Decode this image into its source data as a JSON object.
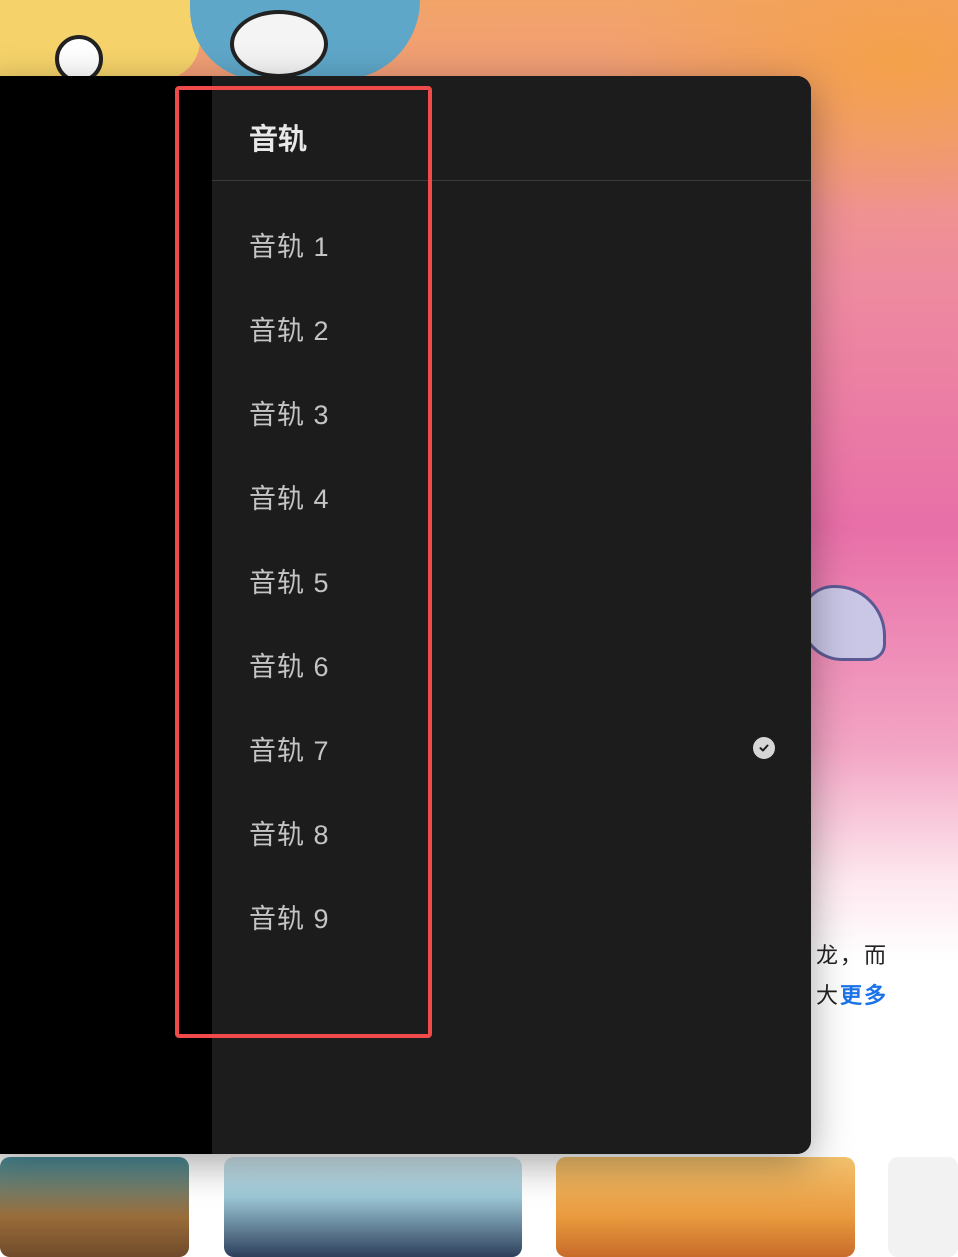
{
  "background": {
    "description_text_line1": "龙，而",
    "description_text_line2": "大",
    "more_link": "更多"
  },
  "audio_panel": {
    "title": "音轨",
    "tracks": [
      {
        "label": "音轨 1",
        "selected": false
      },
      {
        "label": "音轨 2",
        "selected": false
      },
      {
        "label": "音轨 3",
        "selected": false
      },
      {
        "label": "音轨 4",
        "selected": false
      },
      {
        "label": "音轨 5",
        "selected": false
      },
      {
        "label": "音轨 6",
        "selected": false
      },
      {
        "label": "音轨 7",
        "selected": true
      },
      {
        "label": "音轨 8",
        "selected": false
      },
      {
        "label": "音轨 9",
        "selected": false
      }
    ],
    "check_icon": "checkmark-circle-icon"
  },
  "colors": {
    "panel_bg": "#1c1c1c",
    "highlight_border": "#f04a4a",
    "link_blue": "#1a73e8"
  }
}
